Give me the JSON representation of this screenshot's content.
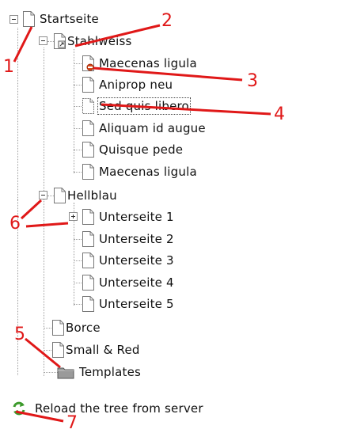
{
  "tree": {
    "root": {
      "label": "Startseite",
      "icon": "page-icon"
    },
    "items": [
      {
        "label": "Stahlweiss",
        "icon": "page-link-icon"
      },
      {
        "label": "Maecenas ligula",
        "icon": "page-hidden-icon"
      },
      {
        "label": "Aniprop neu",
        "icon": "page-icon"
      },
      {
        "label": "Sed quis libero",
        "icon": "page-icon"
      },
      {
        "label": "Aliquam id augue",
        "icon": "page-icon"
      },
      {
        "label": "Quisque pede",
        "icon": "page-icon"
      },
      {
        "label": "Maecenas ligula",
        "icon": "page-icon"
      },
      {
        "label": "Hellblau",
        "icon": "page-icon"
      },
      {
        "label": "Unterseite 1",
        "icon": "page-icon"
      },
      {
        "label": "Unterseite 2",
        "icon": "page-icon"
      },
      {
        "label": "Unterseite 3",
        "icon": "page-icon"
      },
      {
        "label": "Unterseite 4",
        "icon": "page-icon"
      },
      {
        "label": "Unterseite 5",
        "icon": "page-icon"
      },
      {
        "label": "Borce",
        "icon": "page-icon"
      },
      {
        "label": "Small & Red",
        "icon": "page-icon"
      },
      {
        "label": "Templates",
        "icon": "folder-icon"
      }
    ]
  },
  "reload": {
    "label": "Reload the tree from server",
    "icon": "refresh-icon"
  },
  "callouts": [
    "1",
    "2",
    "3",
    "4",
    "5",
    "6",
    "7"
  ],
  "colors": {
    "callout": "#e01818",
    "tree_line": "#a0a0a0",
    "refresh": "#3c9a2c"
  }
}
